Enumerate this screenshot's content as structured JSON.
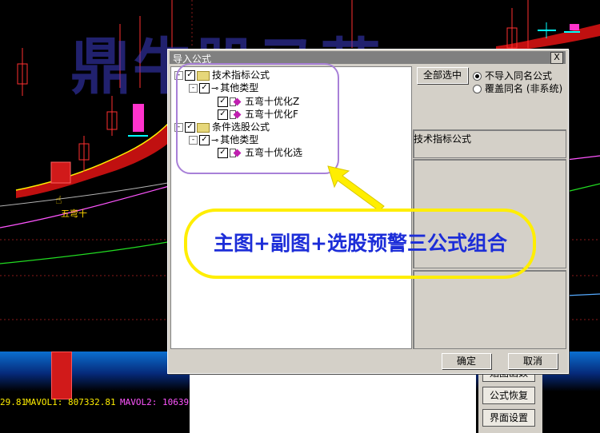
{
  "watermark": "鼎牛股马营",
  "chart_indicator_label": "五弯十",
  "volume_readout": {
    "partial": "29.81",
    "mavol1": "MAVOL1: 807332.81",
    "mavol2": "MAVOL2: 10639"
  },
  "dialog": {
    "title": "导入公式",
    "close_label": "X",
    "tree": [
      {
        "label": "技术指标公式",
        "kind": "folder",
        "checked": true,
        "expander": "-"
      },
      {
        "label": "其他类型",
        "kind": "key",
        "checked": true,
        "expander": "-"
      },
      {
        "label": "五弯十优化Z",
        "kind": "formula",
        "checked": true
      },
      {
        "label": "五弯十优化F",
        "kind": "formula",
        "checked": true
      },
      {
        "label": "条件选股公式",
        "kind": "folder",
        "checked": true,
        "expander": "-"
      },
      {
        "label": "其他类型",
        "kind": "key",
        "checked": true,
        "expander": "-"
      },
      {
        "label": "五弯十优化选",
        "kind": "formula",
        "checked": true
      }
    ],
    "select_all_label": "全部选中",
    "radio_options": [
      {
        "label": "不导入同名公式",
        "selected": true
      },
      {
        "label": "覆盖同名 (非系统)",
        "selected": false
      }
    ],
    "group_label": "技术指标公式",
    "ok_label": "确定",
    "cancel_label": "取消"
  },
  "side_buttons": [
    "贴图函数",
    "公式恢复",
    "界面设置"
  ],
  "annotation": "主图+副图+选股预警三公式组合",
  "colors": {
    "dialog_bg": "#d4d0c8",
    "annotation_border": "#ffee00",
    "annotation_text": "#1c2dd8",
    "highlight": "#a880d8"
  }
}
